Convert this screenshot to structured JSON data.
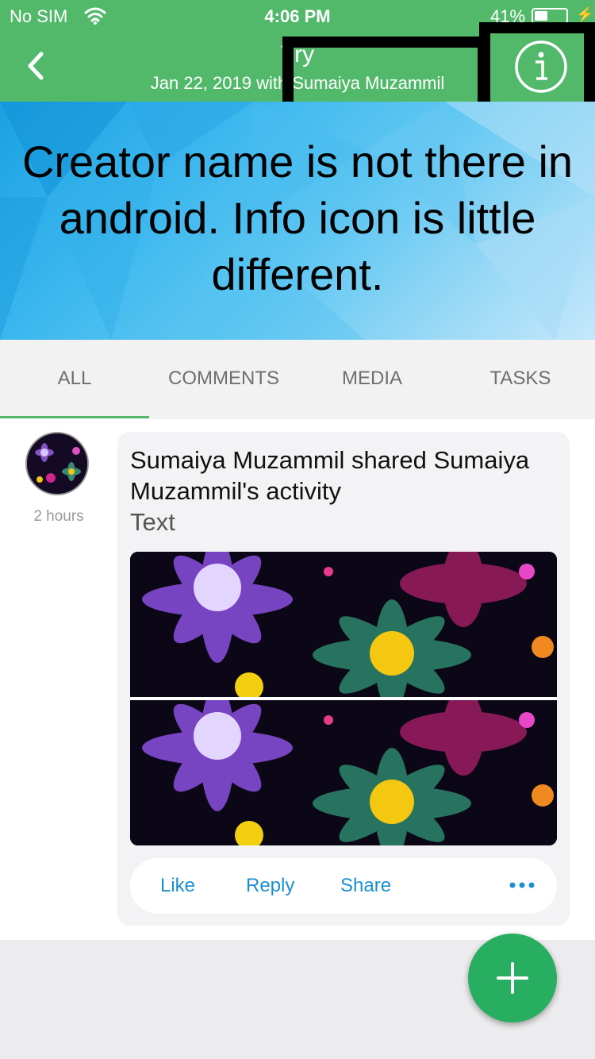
{
  "status_bar": {
    "carrier": "No SIM",
    "time": "4:06 PM",
    "battery": "41%"
  },
  "nav": {
    "title": "Try",
    "subtitle": "Jan 22, 2019 with Sumaiya Muzammil"
  },
  "annotation": {
    "text": "Creator name is not there in android. Info icon is little different."
  },
  "tabs": [
    {
      "label": "ALL",
      "active": true
    },
    {
      "label": "COMMENTS",
      "active": false
    },
    {
      "label": "MEDIA",
      "active": false
    },
    {
      "label": "TASKS",
      "active": false
    }
  ],
  "post": {
    "time_ago": "2 hours",
    "title": "Sumaiya Muzammil shared Sumaiya Muzammil's activity",
    "type": "Text",
    "actions": {
      "like": "Like",
      "reply": "Reply",
      "share": "Share"
    }
  },
  "colors": {
    "primary": "#52b96a",
    "fab": "#27ae60",
    "link": "#1a8fcf"
  },
  "icons": [
    "wifi-icon",
    "battery-icon",
    "back-icon",
    "info-icon",
    "more-icon",
    "plus-icon"
  ]
}
